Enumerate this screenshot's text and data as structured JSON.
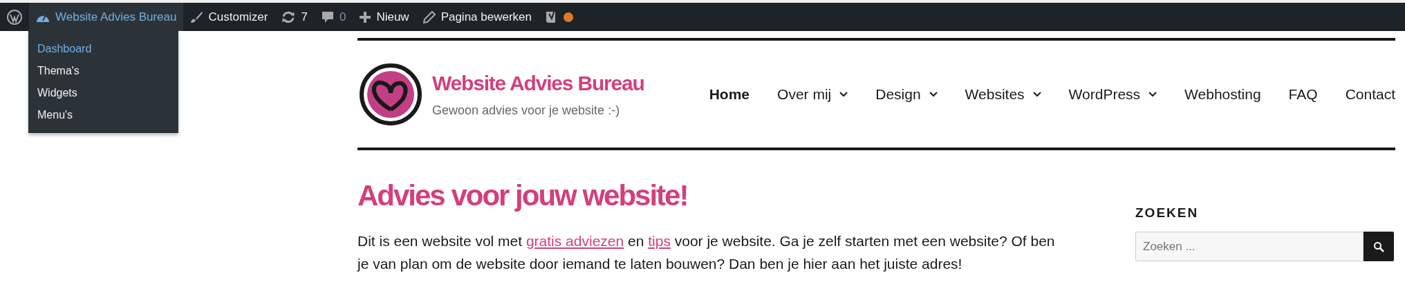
{
  "admin_bar": {
    "items": [
      {
        "kind": "wp-logo",
        "selected": false
      },
      {
        "kind": "site",
        "label": "Website Advies Bureau",
        "selected": true
      },
      {
        "kind": "customizer",
        "label": "Customizer",
        "selected": false
      },
      {
        "kind": "updates",
        "label": "7",
        "selected": false
      },
      {
        "kind": "comments",
        "label": "0",
        "selected": false
      },
      {
        "kind": "new",
        "label": "Nieuw",
        "selected": false
      },
      {
        "kind": "edit",
        "label": "Pagina bewerken",
        "selected": false
      },
      {
        "kind": "seo",
        "color": "#dd7a26",
        "selected": false
      }
    ],
    "submenu": [
      {
        "label": "Dashboard",
        "selected": true
      },
      {
        "label": "Thema's",
        "selected": false
      },
      {
        "label": "Widgets",
        "selected": false
      },
      {
        "label": "Menu's",
        "selected": false
      }
    ]
  },
  "site": {
    "title": "Website Advies Bureau",
    "tagline": "Gewoon advies voor je website :-)"
  },
  "nav": [
    {
      "label": "Home",
      "selected": true,
      "has_submenu": false
    },
    {
      "label": "Over mij",
      "selected": false,
      "has_submenu": true
    },
    {
      "label": "Design",
      "selected": false,
      "has_submenu": true
    },
    {
      "label": "Websites",
      "selected": false,
      "has_submenu": true
    },
    {
      "label": "WordPress",
      "selected": false,
      "has_submenu": true
    },
    {
      "label": "Webhosting",
      "selected": false,
      "has_submenu": false
    },
    {
      "label": "FAQ",
      "selected": false,
      "has_submenu": false
    },
    {
      "label": "Contact",
      "selected": false,
      "has_submenu": false
    }
  ],
  "content": {
    "heading": "Advies voor jouw website!",
    "paragraph": [
      {
        "kind": "text",
        "text": "Dit is een website vol met "
      },
      {
        "kind": "link",
        "text": "gratis adviezen"
      },
      {
        "kind": "text",
        "text": " en "
      },
      {
        "kind": "link",
        "text": "tips"
      },
      {
        "kind": "text",
        "text": " voor je website. Ga je zelf starten met een website? Of ben je van plan om de website door iemand te laten bouwen? Dan ben je hier aan het juiste adres!"
      }
    ]
  },
  "sidebar": {
    "widget_title": "ZOEKEN",
    "search": {
      "placeholder": "Zoeken ..."
    }
  }
}
